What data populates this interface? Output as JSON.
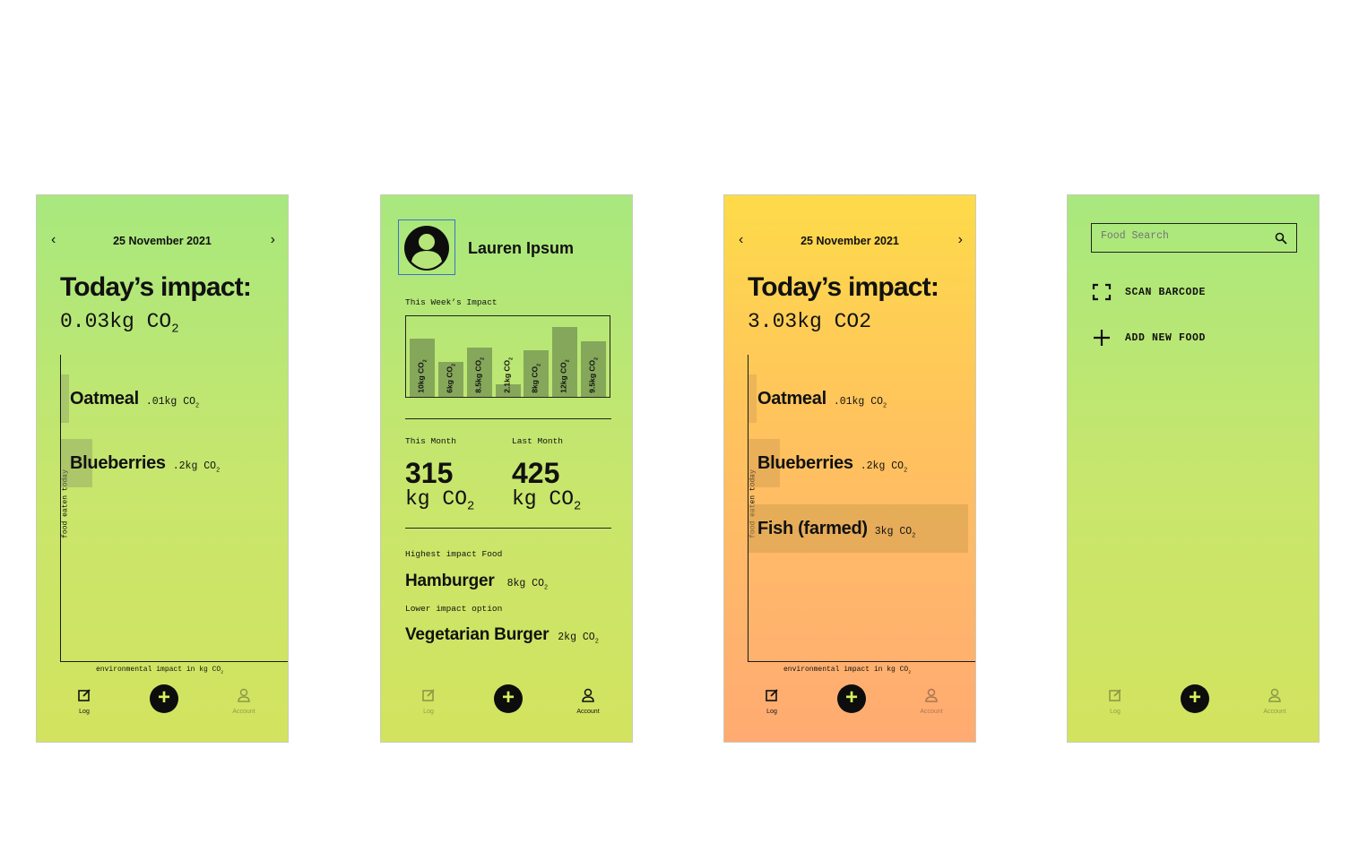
{
  "colors": {
    "green_top": "#a8e87e",
    "green_bottom": "#d3e35f",
    "orange_top": "#fedb4a",
    "orange_bottom": "#ffaa72",
    "button": "#0d0d0d",
    "plus": "#d6f25a"
  },
  "nav": {
    "log": "Log",
    "account": "Account",
    "add": "+"
  },
  "screen1": {
    "date": "25 November 2021",
    "prev": "‹",
    "next": "›",
    "title": "Today’s impact:",
    "impact_value": "0.03kg CO",
    "impact_sub": "2",
    "y_axis_label": "food eaten today",
    "x_axis_label": "environmental impact in kg CO",
    "x_axis_sub": "2",
    "foods": [
      {
        "name": "Oatmeal",
        "co2": ".01kg CO",
        "sub": "2"
      },
      {
        "name": "Blueberries",
        "co2": ".2kg CO",
        "sub": "2"
      }
    ]
  },
  "screen2": {
    "user_name": "Lauren Ipsum",
    "week_label": "This Week’s Impact",
    "week_bars": [
      {
        "label": "10kg CO",
        "sub": "2",
        "value": 10
      },
      {
        "label": "6kg CO",
        "sub": "2",
        "value": 6
      },
      {
        "label": "8.5kg CO",
        "sub": "2",
        "value": 8.5
      },
      {
        "label": "2.1kg CO",
        "sub": "2",
        "value": 2.1
      },
      {
        "label": "8kg CO",
        "sub": "2",
        "value": 8
      },
      {
        "label": "12kg CO",
        "sub": "2",
        "value": 12
      },
      {
        "label": "9.5kg CO",
        "sub": "2",
        "value": 9.5
      }
    ],
    "this_month_label": "This Month",
    "this_month_value": "315",
    "last_month_label": "Last Month",
    "last_month_value": "425",
    "unit": "kg CO",
    "unit_sub": "2",
    "highest_label": "Highest impact Food",
    "highest_food": "Hamburger",
    "highest_co2": "8kg CO",
    "highest_sub": "2",
    "lower_label": "Lower impact option",
    "lower_food": "Vegetarian Burger",
    "lower_co2": "2kg CO",
    "lower_sub": "2"
  },
  "screen3": {
    "date": "25 November 2021",
    "prev": "‹",
    "next": "›",
    "title": "Today’s impact:",
    "impact_value": "3.03kg CO2",
    "y_axis_label": "food eaten today",
    "x_axis_label": "environmental impact in kg CO",
    "x_axis_sub": "2",
    "foods": [
      {
        "name": "Oatmeal",
        "co2": ".01kg CO",
        "sub": "2"
      },
      {
        "name": "Blueberries",
        "co2": ".2kg CO",
        "sub": "2"
      },
      {
        "name": "Fish (farmed)",
        "co2": "3kg CO",
        "sub": "2"
      }
    ]
  },
  "screen4": {
    "search_placeholder": "Food Search",
    "scan_label": "SCAN BARCODE",
    "add_label": "ADD NEW FOOD"
  }
}
